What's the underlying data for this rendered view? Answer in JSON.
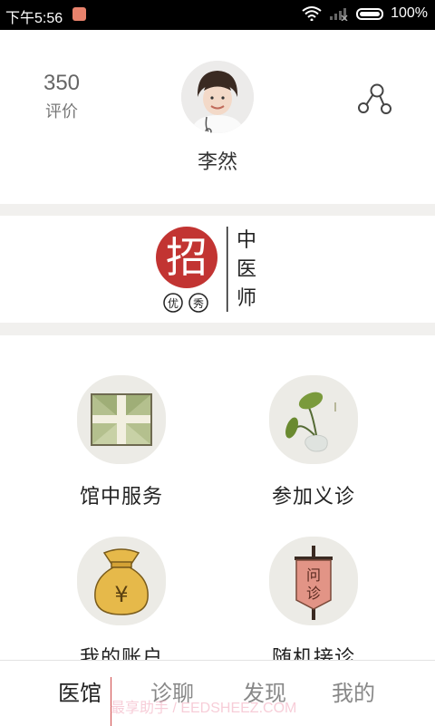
{
  "status_bar": {
    "time": "下午5:56",
    "battery": "100%"
  },
  "profile": {
    "rating_count": "350",
    "rating_label": "评价",
    "doctor_name": "李然"
  },
  "brand": {
    "logo_char": "招",
    "sub_left": "优",
    "sub_right": "秀",
    "vertical_title": [
      "中",
      "医",
      "师"
    ]
  },
  "services": [
    {
      "label": "馆中服务",
      "icon": "package-icon"
    },
    {
      "label": "参加义诊",
      "icon": "plant-vase-icon"
    },
    {
      "label": "我的账户",
      "icon": "money-bag-icon"
    },
    {
      "label": "随机接诊",
      "icon": "banner-icon",
      "banner_chars": [
        "问",
        "诊"
      ]
    }
  ],
  "tabs": [
    "医馆",
    "诊聊",
    "发现",
    "我的"
  ],
  "active_tab": "医馆",
  "watermark": "最享助手 / EEDSHEEZ.COM",
  "colors": {
    "brand_red": "#c23432",
    "tile_bg": "#ecebe6"
  }
}
